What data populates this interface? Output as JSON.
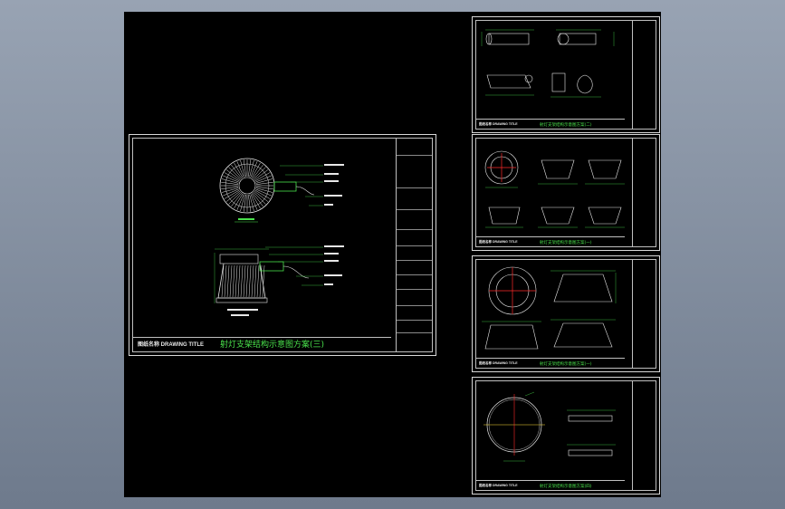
{
  "main_sheet": {
    "drawing_title_label": "图纸名称 DRAWING TITLE",
    "drawing_title": "射灯支架结构示意图方案(三)"
  },
  "sheets": [
    {
      "title_label": "图纸名称 DRAWING TITLE",
      "title": "射灯支架结构示意图方案(二)"
    },
    {
      "title_label": "图纸名称 DRAWING TITLE",
      "title": "射灯支架结构示意图方案(一)"
    },
    {
      "title_label": "图纸名称 DRAWING TITLE",
      "title": "射灯支架结构示意图方案(一)"
    },
    {
      "title_label": "图纸名称 DRAWING TITLE",
      "title": "射灯支架结构示意图方案(四)"
    }
  ],
  "colors": {
    "background": "#000000",
    "line_green": "#49e04b",
    "line_white": "#e8e8e8",
    "line_red": "#ff2a2a",
    "line_yellow": "#ffe23a",
    "window_grey": "#7f8a9c"
  }
}
